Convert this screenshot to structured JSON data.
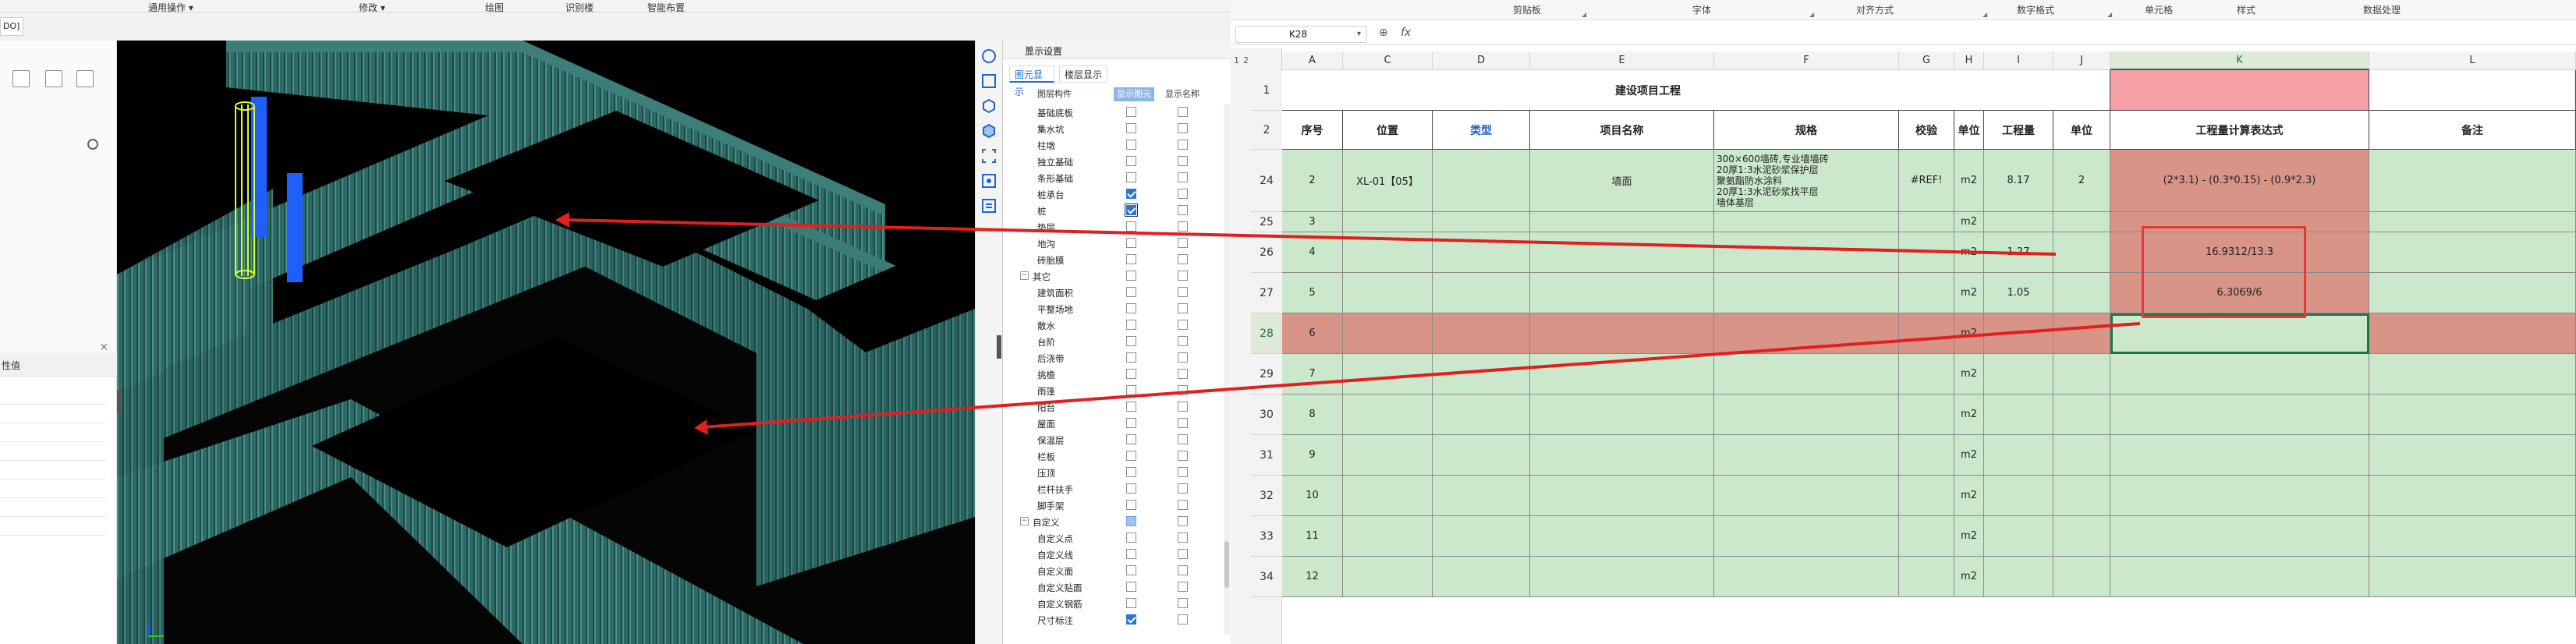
{
  "left_app": {
    "ribbon": [
      "通用操作 ▾",
      "修改 ▾",
      "绘图",
      "识别楼",
      "智能布置"
    ],
    "combo_value": "DO]",
    "props_header": "性值",
    "display_panel": {
      "title": "显示设置",
      "tabs": [
        "图元显示",
        "楼层显示"
      ],
      "col_headers": [
        "图层构件",
        "显示图元",
        "显示名称"
      ],
      "rows": [
        {
          "label": "基础底板",
          "show": false,
          "name": false,
          "indent": 2
        },
        {
          "label": "集水坑",
          "show": false,
          "name": false,
          "indent": 2
        },
        {
          "label": "柱墩",
          "show": false,
          "name": false,
          "indent": 2
        },
        {
          "label": "独立基础",
          "show": false,
          "name": false,
          "indent": 2
        },
        {
          "label": "条形基础",
          "show": false,
          "name": false,
          "indent": 2
        },
        {
          "label": "桩承台",
          "show": true,
          "name": false,
          "indent": 2
        },
        {
          "label": "桩",
          "show": true,
          "name": false,
          "indent": 2,
          "focus": true
        },
        {
          "label": "垫层",
          "show": false,
          "name": false,
          "indent": 2
        },
        {
          "label": "地沟",
          "show": false,
          "name": false,
          "indent": 2
        },
        {
          "label": "砖胎膜",
          "show": false,
          "name": false,
          "indent": 2
        },
        {
          "label": "其它",
          "show": false,
          "name": false,
          "indent": 1,
          "toggle": "−"
        },
        {
          "label": "建筑面积",
          "show": false,
          "name": false,
          "indent": 2
        },
        {
          "label": "平整场地",
          "show": false,
          "name": false,
          "indent": 2
        },
        {
          "label": "散水",
          "show": false,
          "name": false,
          "indent": 2
        },
        {
          "label": "台阶",
          "show": false,
          "name": false,
          "indent": 2
        },
        {
          "label": "后浇带",
          "show": false,
          "name": false,
          "indent": 2
        },
        {
          "label": "挑檐",
          "show": false,
          "name": false,
          "indent": 2
        },
        {
          "label": "雨篷",
          "show": false,
          "name": false,
          "indent": 2
        },
        {
          "label": "阳台",
          "show": false,
          "name": false,
          "indent": 2
        },
        {
          "label": "屋面",
          "show": false,
          "name": false,
          "indent": 2
        },
        {
          "label": "保温层",
          "show": false,
          "name": false,
          "indent": 2
        },
        {
          "label": "栏板",
          "show": false,
          "name": false,
          "indent": 2
        },
        {
          "label": "压顶",
          "show": false,
          "name": false,
          "indent": 2
        },
        {
          "label": "栏杆扶手",
          "show": false,
          "name": false,
          "indent": 2
        },
        {
          "label": "脚手架",
          "show": false,
          "name": false,
          "indent": 2
        },
        {
          "label": "自定义",
          "show": "partial",
          "name": false,
          "indent": 1,
          "toggle": "−"
        },
        {
          "label": "自定义点",
          "show": false,
          "name": false,
          "indent": 2
        },
        {
          "label": "自定义线",
          "show": false,
          "name": false,
          "indent": 2
        },
        {
          "label": "自定义面",
          "show": false,
          "name": false,
          "indent": 2
        },
        {
          "label": "自定义贴面",
          "show": false,
          "name": false,
          "indent": 2
        },
        {
          "label": "自定义钢筋",
          "show": false,
          "name": false,
          "indent": 2
        },
        {
          "label": "尺寸标注",
          "show": true,
          "name": false,
          "indent": 2
        }
      ]
    },
    "colors": {
      "wall": "#2e6e6a",
      "highlight": "#1f5fff",
      "pile": "#d6ff2a",
      "arrow": "#e02020"
    }
  },
  "sheet": {
    "ribbon_groups": [
      "剪贴板",
      "字体",
      "对齐方式",
      "数字格式",
      "单元格",
      "样式",
      "数据处理"
    ],
    "name_box": "K28",
    "fx": "fx",
    "outline_levels": [
      "1",
      "2"
    ],
    "columns": [
      "A",
      "C",
      "D",
      "E",
      "F",
      "G",
      "H",
      "I",
      "J",
      "K",
      "L"
    ],
    "title": "建设项目工程",
    "headers": [
      "序号",
      "位置",
      "类型",
      "项目名称",
      "规格",
      "校验",
      "单位",
      "工程量",
      "单位",
      "工程量计算表达式",
      "备注"
    ],
    "rows": [
      {
        "num": "1"
      },
      {
        "num": "2"
      },
      {
        "num": "24",
        "cells": [
          "2",
          "XL-01【05】",
          "",
          "墙面",
          "",
          "#REF!",
          "m2",
          "8.17",
          "2",
          "(2*3.1) - (0.3*0.15) - (0.9*2.3)",
          ""
        ],
        "spec_lines": [
          "300×600墙砖,专业墙墙砖",
          "20厚1:3水泥砂浆保护层",
          "聚氨酯防水涂料",
          "20厚1:3水泥砂浆找平层",
          "墙体基层"
        ]
      },
      {
        "num": "25",
        "cells": [
          "3",
          "",
          "",
          "",
          "",
          "",
          "m2",
          "",
          "",
          "",
          ""
        ]
      },
      {
        "num": "26",
        "cells": [
          "4",
          "",
          "",
          "",
          "",
          "",
          "m2",
          "1.27",
          "",
          "16.9312/13.3",
          ""
        ]
      },
      {
        "num": "27",
        "cells": [
          "5",
          "",
          "",
          "",
          "",
          "",
          "m2",
          "1.05",
          "",
          "6.3069/6",
          ""
        ]
      },
      {
        "num": "28",
        "cells": [
          "6",
          "",
          "",
          "",
          "",
          "",
          "m2",
          "",
          "",
          "",
          ""
        ]
      },
      {
        "num": "29",
        "cells": [
          "7",
          "",
          "",
          "",
          "",
          "",
          "m2",
          "",
          "",
          "",
          ""
        ]
      },
      {
        "num": "30",
        "cells": [
          "8",
          "",
          "",
          "",
          "",
          "",
          "m2",
          "",
          "",
          "",
          ""
        ]
      },
      {
        "num": "31",
        "cells": [
          "9",
          "",
          "",
          "",
          "",
          "",
          "m2",
          "",
          "",
          "",
          ""
        ]
      },
      {
        "num": "32",
        "cells": [
          "10",
          "",
          "",
          "",
          "",
          "",
          "m2",
          "",
          "",
          "",
          ""
        ]
      },
      {
        "num": "33",
        "cells": [
          "11",
          "",
          "",
          "",
          "",
          "",
          "m2",
          "",
          "",
          "",
          ""
        ]
      },
      {
        "num": "34",
        "cells": [
          "12",
          "",
          "",
          "",
          "",
          "",
          "m2",
          "",
          "",
          "",
          ""
        ]
      }
    ],
    "colors": {
      "green": "#cbe8cc",
      "red": "#d99488",
      "pink": "#f4a0a5",
      "select": "#217346",
      "annot": "#e53935"
    }
  }
}
